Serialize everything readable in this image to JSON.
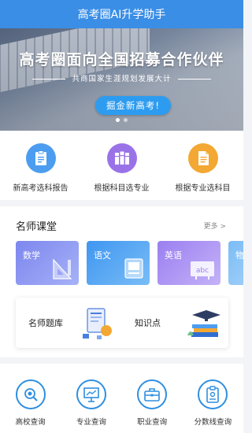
{
  "app": {
    "title": "高考圈AI升学助手"
  },
  "banner": {
    "headline": "高考圈面向全国招募合作伙伴",
    "subline": "共商国家生涯规划发展大计",
    "cta_label": "掘金新高考!",
    "page_indicator": {
      "total": 2,
      "current": 1
    }
  },
  "quick_actions": [
    {
      "label": "新高考选科报告",
      "icon": "report-icon",
      "color": "#4c9df0"
    },
    {
      "label": "根据科目选专业",
      "icon": "books-icon",
      "color": "#9a72e8"
    },
    {
      "label": "根据专业选科目",
      "icon": "document-icon",
      "color": "#f3a833"
    }
  ],
  "teachers": {
    "title": "名师课堂",
    "more_label": "更多 >",
    "subjects": [
      {
        "label": "数学",
        "icon": "ruler-triangle-icon",
        "color": "#8c95f2"
      },
      {
        "label": "语文",
        "icon": "book-icon",
        "color": "#4aa2f3"
      },
      {
        "label": "英语",
        "icon": "abc-board-icon",
        "color": "#a98af0"
      },
      {
        "label": "物",
        "icon": "physics-icon",
        "color": "#8fc6f6"
      }
    ],
    "tools": [
      {
        "label": "名师题库",
        "icon": "question-bank-icon"
      },
      {
        "label": "知识点",
        "icon": "graduation-books-icon"
      }
    ]
  },
  "bottom_nav": [
    {
      "label": "高校查询",
      "icon": "search-icon"
    },
    {
      "label": "专业查询",
      "icon": "presentation-icon"
    },
    {
      "label": "职业查询",
      "icon": "briefcase-icon"
    },
    {
      "label": "分数线查询",
      "icon": "clipboard-icon"
    }
  ]
}
